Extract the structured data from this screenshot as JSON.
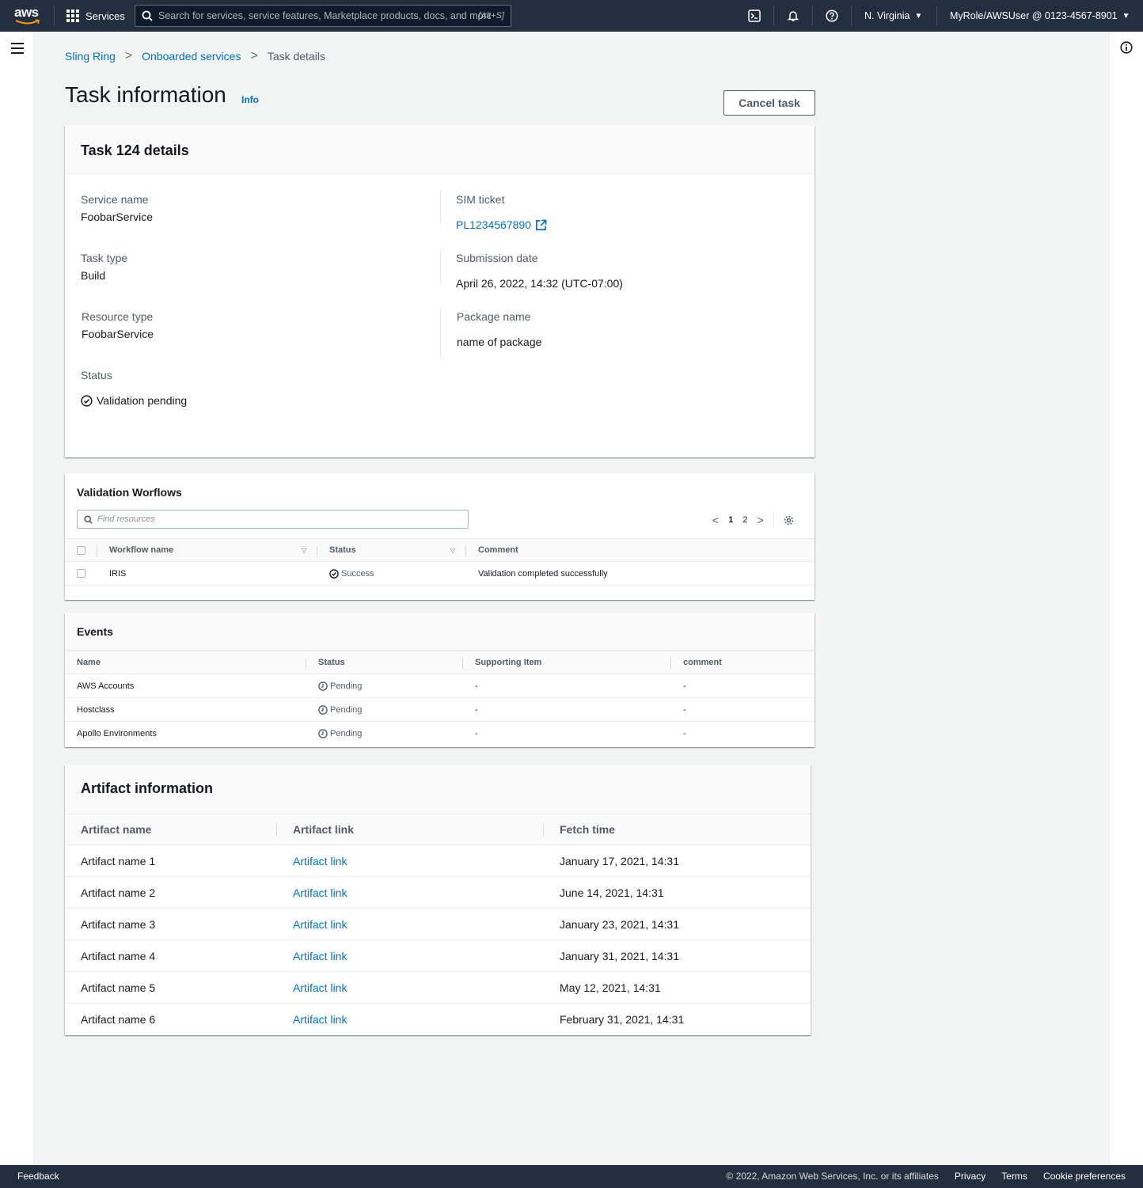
{
  "topnav": {
    "logo_text": "aws",
    "services_label": "Services",
    "search_placeholder": "Search for services, service features, Marketplace products, docs, and more",
    "search_shortcut": "[Alt+S]",
    "region_label": "N. Virginia",
    "account_label": "MyRole/AWSUser @ 0123-4567-8901",
    "icons": [
      "cloudshell-icon",
      "bell-icon",
      "help-icon"
    ]
  },
  "breadcrumb": {
    "items": [
      "Sling Ring",
      "Onboarded services"
    ],
    "current": "Task details"
  },
  "header": {
    "title": "Task information",
    "info_label": "Info",
    "cancel_label": "Cancel task"
  },
  "task_details": {
    "title": "Task 124 details",
    "service_name": {
      "label": "Service name",
      "value": "FoobarService"
    },
    "task_type": {
      "label": "Task type",
      "value": "Build"
    },
    "resource_type": {
      "label": "Resource type",
      "value": "FoobarService"
    },
    "status": {
      "label": "Status",
      "value": "Validation pending"
    },
    "sim_ticket": {
      "label": "SIM ticket",
      "value": "PL1234567890"
    },
    "submission_date": {
      "label": "Submission date",
      "value": "April 26, 2022, 14:32 (UTC-07:00)"
    },
    "package_name": {
      "label": "Package name",
      "value": "name of package"
    }
  },
  "workflows": {
    "title": "Validation Worflows",
    "search_placeholder": "Find resources",
    "pages": [
      "1",
      "2"
    ],
    "columns": [
      "Workflow name",
      "Status",
      "Comment"
    ],
    "rows": [
      {
        "name": "IRIS",
        "status": "Success",
        "comment": "Validation completed successfully"
      }
    ]
  },
  "events": {
    "title": "Events",
    "columns": [
      "Name",
      "Status",
      "Supporting Item",
      "comment"
    ],
    "rows": [
      {
        "name": "AWS Accounts",
        "status": "Pending",
        "item": "-",
        "comment": "-"
      },
      {
        "name": "Hostclass",
        "status": "Pending",
        "item": "-",
        "comment": "-"
      },
      {
        "name": "Apollo Environments",
        "status": "Pending",
        "item": "-",
        "comment": "-"
      }
    ]
  },
  "artifacts": {
    "title": "Artifact information",
    "columns": [
      "Artifact name",
      "Artifact link",
      "Fetch time"
    ],
    "rows": [
      {
        "name": "Artifact name 1",
        "link": "Artifact link",
        "time": "January 17, 2021, 14:31"
      },
      {
        "name": "Artifact name 2",
        "link": "Artifact link",
        "time": "June 14, 2021, 14:31"
      },
      {
        "name": "Artifact name 3",
        "link": "Artifact link",
        "time": "January 23, 2021, 14:31"
      },
      {
        "name": "Artifact name 4",
        "link": "Artifact link",
        "time": "January 31, 2021, 14:31"
      },
      {
        "name": "Artifact name 5",
        "link": "Artifact link",
        "time": "May 12, 2021, 14:31"
      },
      {
        "name": "Artifact name 6",
        "link": "Artifact link",
        "time": "February 31, 2021, 14:31"
      }
    ]
  },
  "footer": {
    "feedback": "Feedback",
    "copyright": "© 2022, Amazon Web Services, Inc. or its affiliates",
    "links": [
      "Privacy",
      "Terms",
      "Cookie preferences"
    ]
  },
  "colors": {
    "nav_bg": "#232f3e",
    "link": "#0073bb",
    "page_bg": "#f2f3f3"
  }
}
